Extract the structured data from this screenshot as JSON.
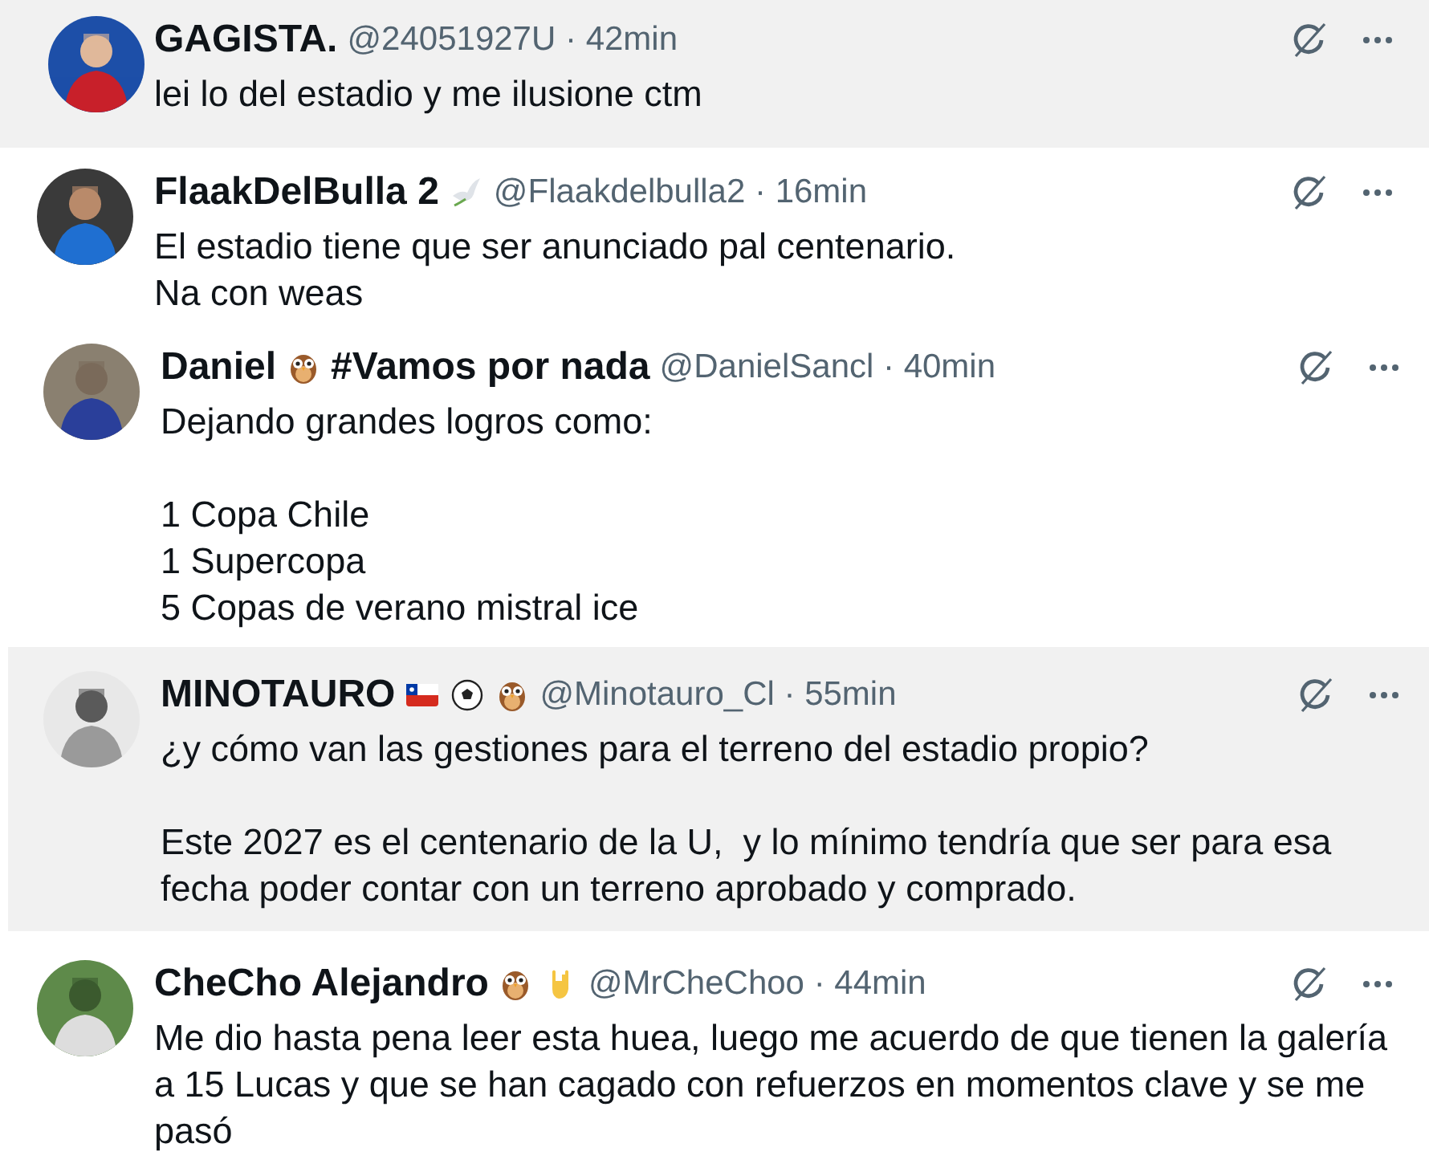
{
  "replies": [
    {
      "name": "GAGISTA.",
      "meta": "@24051927U · 42min",
      "text": "lei lo del estadio y me ilusione ctm",
      "shaded": true
    },
    {
      "name": "FlaakDelBulla 2",
      "badges": [
        {
          "kind": "dove"
        }
      ],
      "meta": "@Flaakdelbulla2 · 16min",
      "text": "El estadio tiene que ser anunciado pal centenario.\nNa con weas",
      "shaded": false
    },
    {
      "name": "Daniel",
      "badges": [
        {
          "kind": "owl"
        }
      ],
      "name_suffix": "#Vamos por nada",
      "meta": "@DanielSancl · 40min",
      "text": "Dejando grandes logros como:\n\n1 Copa Chile\n1 Supercopa\n5 Copas de verano mistral ice",
      "shaded": false
    },
    {
      "name": "MINOTAURO",
      "badges": [
        {
          "kind": "flag"
        },
        {
          "kind": "ball"
        },
        {
          "kind": "owl"
        }
      ],
      "meta": "@Minotauro_Cl · 55min",
      "text": "¿y cómo van las gestiones para el terreno del estadio propio?\n\nEste 2027 es el centenario de la U,  y lo mínimo tendría que ser para esa fecha poder contar con un terreno aprobado y comprado.",
      "shaded": true
    },
    {
      "name": "CheCho Alejandro",
      "badges": [
        {
          "kind": "owl"
        },
        {
          "kind": "hand"
        }
      ],
      "meta": "@MrCheChoo · 44min",
      "text": "Me dio hasta pena leer esta huea, luego me acuerdo de que tienen la galería a 15 Lucas y que se han cagado con refuerzos en momentos clave y se me pasó",
      "shaded": false
    }
  ]
}
